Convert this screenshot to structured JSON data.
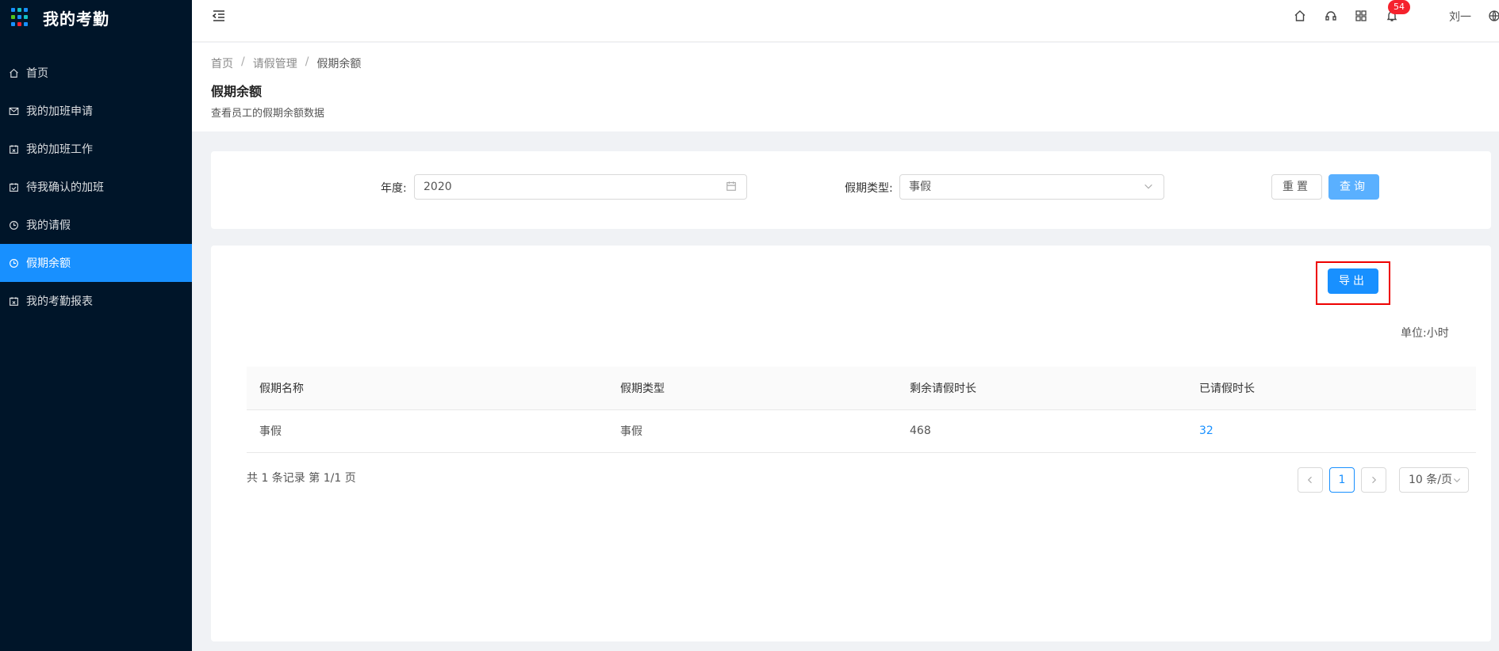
{
  "app": {
    "title": "我的考勤"
  },
  "sidebar": {
    "items": [
      {
        "label": "首页",
        "icon": "home-icon"
      },
      {
        "label": "我的加班申请",
        "icon": "mail-icon"
      },
      {
        "label": "我的加班工作",
        "icon": "calendar-x-icon"
      },
      {
        "label": "待我确认的加班",
        "icon": "check-square-icon"
      },
      {
        "label": "我的请假",
        "icon": "clock-icon"
      },
      {
        "label": "假期余额",
        "icon": "clock-icon",
        "active": true
      },
      {
        "label": "我的考勤报表",
        "icon": "calendar-x-icon"
      }
    ]
  },
  "header": {
    "notifications_count": "54",
    "user_name": "刘一"
  },
  "breadcrumb": {
    "items": [
      "首页",
      "请假管理",
      "假期余额"
    ]
  },
  "page": {
    "title": "假期余额",
    "description": "查看员工的假期余额数据"
  },
  "filter": {
    "year_label": "年度:",
    "year_value": "2020",
    "type_label": "假期类型:",
    "type_value": "事假",
    "reset_label": "重置",
    "query_label": "查询"
  },
  "toolbar": {
    "export_label": "导出",
    "unit_text": "单位:小时"
  },
  "table": {
    "columns": [
      "假期名称",
      "假期类型",
      "剩余请假时长",
      "已请假时长"
    ],
    "rows": [
      [
        "事假",
        "事假",
        "468",
        "32"
      ]
    ]
  },
  "pagination": {
    "total_text": "共 1 条记录 第 1/1 页",
    "current_page": "1",
    "page_size": "10 条/页"
  },
  "colors": {
    "sidebar_bg": "#001529",
    "primary": "#1890ff",
    "highlight": "#ee0000"
  }
}
